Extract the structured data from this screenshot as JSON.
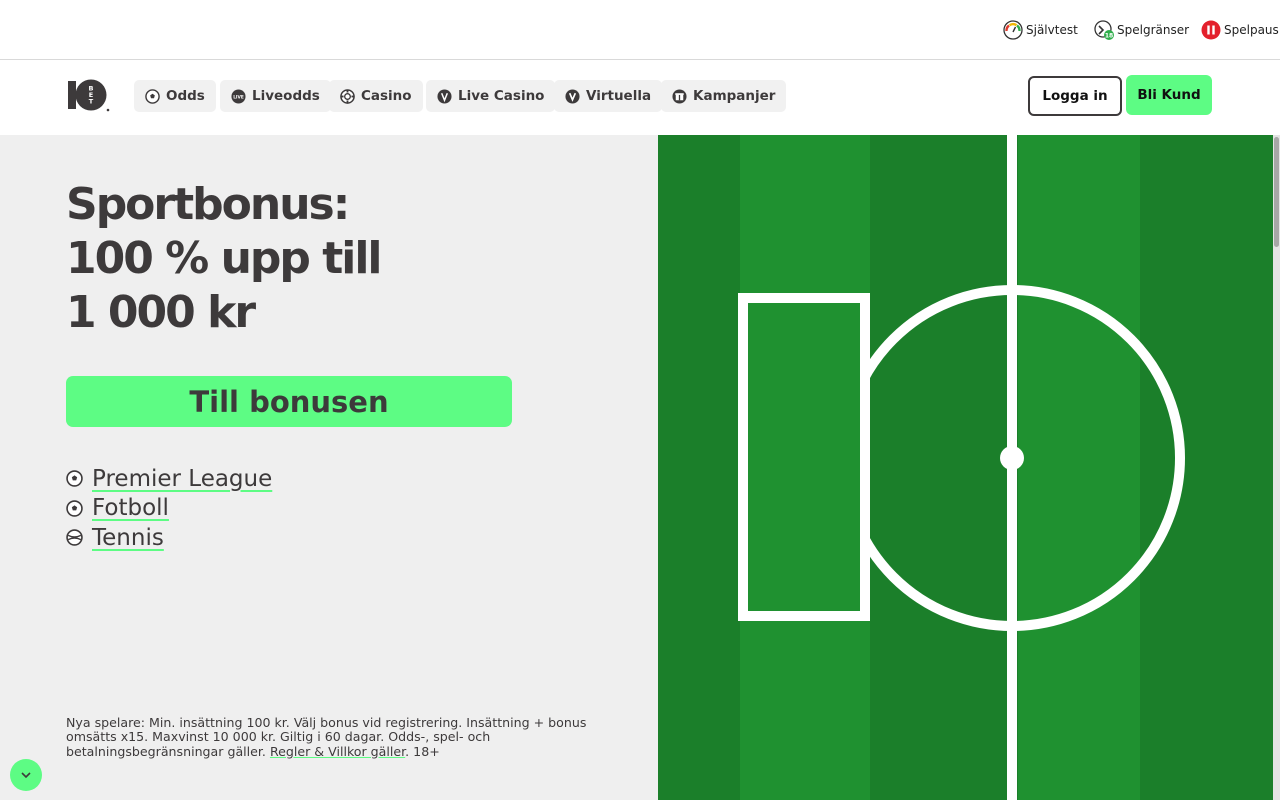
{
  "utility": {
    "self_test": "Självtest",
    "limits": "Spelgränser",
    "pause": "Spelpaus"
  },
  "nav": {
    "logo_text": "10 BET",
    "items": [
      {
        "label": "Odds",
        "icon": "soccer-ball-icon"
      },
      {
        "label": "Liveodds",
        "icon": "live-badge-icon"
      },
      {
        "label": "Casino",
        "icon": "casino-chip-icon"
      },
      {
        "label": "Live Casino",
        "icon": "live-dealer-icon"
      },
      {
        "label": "Virtuella",
        "icon": "virtual-icon"
      },
      {
        "label": "Kampanjer",
        "icon": "gift-icon"
      }
    ],
    "login": "Logga in",
    "signup": "Bli Kund"
  },
  "hero": {
    "headline_lines": [
      "Sportbonus:",
      "100 % upp till",
      "1 000 kr"
    ],
    "cta": "Till bonusen",
    "sport_links": [
      {
        "label": "Premier League",
        "icon": "soccer-ball-icon"
      },
      {
        "label": "Fotboll",
        "icon": "soccer-ball-icon"
      },
      {
        "label": "Tennis",
        "icon": "tennis-ball-icon"
      }
    ],
    "terms_text": "Nya spelare: Min. insättning 100 kr. Välj bonus vid registrering. Insättning + bonus omsätts x15. Maxvinst 10 000 kr. Giltig i 60 dagar. Odds-, spel- och betalningsbegränsningar gäller. ",
    "terms_link": "Regler & Villkor gäller",
    "terms_suffix": ". 18+"
  },
  "colors": {
    "accent_green": "#5dfc84",
    "text_dark": "#3d3a3b",
    "pitch_light": "#1f9130",
    "pitch_dark": "#1b7f2a"
  }
}
